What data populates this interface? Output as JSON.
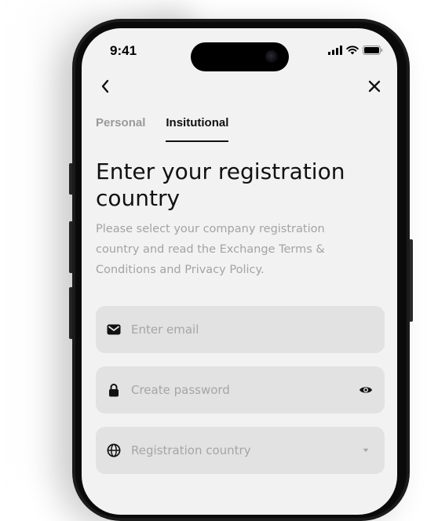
{
  "status_bar": {
    "time": "9:41"
  },
  "nav": {
    "back_icon": "chevron-left-icon",
    "close_icon": "close-icon"
  },
  "tabs": [
    {
      "label": "Personal",
      "active": false
    },
    {
      "label": "Insitutional",
      "active": true
    }
  ],
  "page": {
    "title": "Enter your registration country",
    "subtitle": "Please select your company registration country and read the Exchange Terms & Conditions and Privacy Policy."
  },
  "form": {
    "email": {
      "placeholder": "Enter email",
      "icon": "mail-icon"
    },
    "password": {
      "placeholder": "Create password",
      "icon": "lock-icon",
      "toggle_icon": "eye-icon"
    },
    "country": {
      "placeholder": "Registration country",
      "icon": "globe-icon",
      "dropdown_icon": "caret-down-icon"
    }
  },
  "colors": {
    "screen_bg": "#f2f2f2",
    "field_bg": "#e2e2e2",
    "text_primary": "#111111",
    "text_muted": "#a3a3a3"
  }
}
